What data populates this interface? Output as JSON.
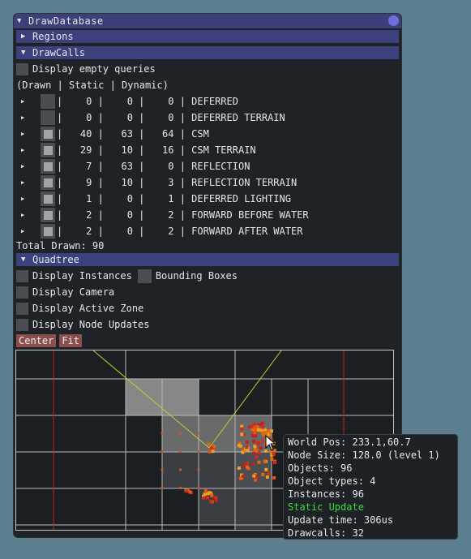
{
  "window": {
    "title": "DrawDatabase"
  },
  "regions": {
    "label": "Regions"
  },
  "drawcalls": {
    "label": "DrawCalls",
    "empty_queries_label": "Display empty queries",
    "columns_header": "(Drawn | Static | Dynamic)",
    "rows": [
      {
        "text": "|    0 |    0 |    0 | DEFERRED",
        "checked": false
      },
      {
        "text": "|    0 |    0 |    0 | DEFERRED TERRAIN",
        "checked": false
      },
      {
        "text": "|   40 |   63 |   64 | CSM",
        "checked": true
      },
      {
        "text": "|   29 |   10 |   16 | CSM TERRAIN",
        "checked": true
      },
      {
        "text": "|    7 |   63 |    0 | REFLECTION",
        "checked": true
      },
      {
        "text": "|    9 |   10 |    3 | REFLECTION TERRAIN",
        "checked": true
      },
      {
        "text": "|    1 |    0 |    1 | DEFERRED LIGHTING",
        "checked": true
      },
      {
        "text": "|    2 |    0 |    2 | FORWARD BEFORE WATER",
        "checked": true
      },
      {
        "text": "|    2 |    0 |    2 | FORWARD AFTER WATER",
        "checked": true
      }
    ],
    "total": "Total Drawn: 90"
  },
  "quadtree": {
    "label": "Quadtree",
    "instances_label": "Display Instances",
    "bbox_label": "Bounding Boxes",
    "camera_label": "Display Camera",
    "active_zone_label": "Display Active Zone",
    "node_updates_label": "Display Node Updates",
    "center_button": "Center",
    "fit_button": "Fit"
  },
  "tooltip": {
    "world_pos": "World Pos: 233.1,60.7",
    "node_size": "Node Size: 128.0 (level 1)",
    "objects": "Objects: 96",
    "object_types": "Object types: 4",
    "instances": "Instances: 96",
    "status": "Static Update",
    "update_time": "Update time: 306us",
    "drawcalls": "Drawcalls: 32"
  },
  "colors": {
    "header": "#3c407d",
    "button": "#8a4f4b",
    "status_green": "#3cdc3c",
    "zone_red": "#c41e1e",
    "camera_yellow": "#c8c832"
  }
}
